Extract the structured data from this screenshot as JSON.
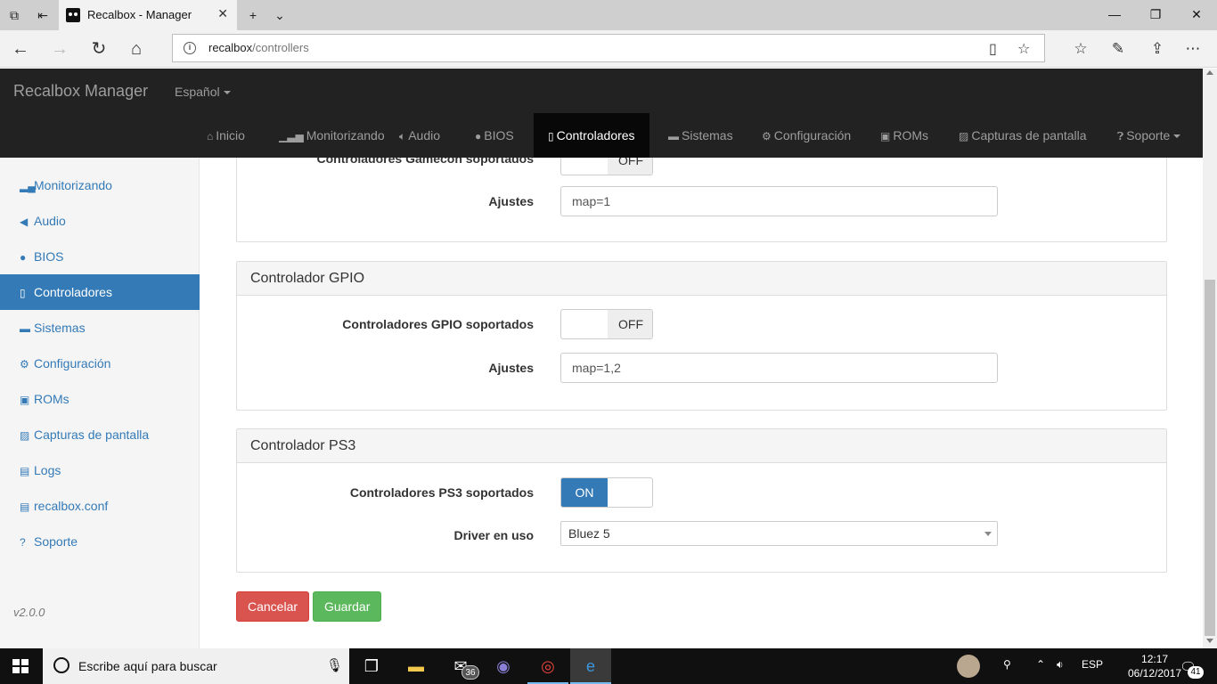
{
  "browser": {
    "tab_title": "Recalbox - Manager",
    "url_host": "recalbox",
    "url_path": "/controllers"
  },
  "navbar": {
    "brand": "Recalbox Manager",
    "language": "Español",
    "items": [
      {
        "label": "Inicio",
        "icon": "home-icon"
      },
      {
        "label": "Monitorizando",
        "icon": "signal-icon"
      },
      {
        "label": "Audio",
        "icon": "volume-icon"
      },
      {
        "label": "BIOS",
        "icon": "globe-icon"
      },
      {
        "label": "Controladores",
        "icon": "phone-icon"
      },
      {
        "label": "Sistemas",
        "icon": "hdd-icon"
      },
      {
        "label": "Configuración",
        "icon": "cog-icon"
      },
      {
        "label": "ROMs",
        "icon": "floppy-icon"
      },
      {
        "label": "Capturas de pantalla",
        "icon": "picture-icon"
      },
      {
        "label": "Soporte",
        "icon": "question-icon"
      }
    ]
  },
  "sidebar": {
    "items": [
      {
        "label": "Monitorizando"
      },
      {
        "label": "Audio"
      },
      {
        "label": "BIOS"
      },
      {
        "label": "Controladores"
      },
      {
        "label": "Sistemas"
      },
      {
        "label": "Configuración"
      },
      {
        "label": "ROMs"
      },
      {
        "label": "Capturas de pantalla"
      },
      {
        "label": "Logs"
      },
      {
        "label": "recalbox.conf"
      },
      {
        "label": "Soporte"
      }
    ],
    "version": "v2.0.0"
  },
  "gamecon": {
    "supported_label": "Controladores Gamecon soportados",
    "supported_state": "OFF",
    "settings_label": "Ajustes",
    "settings_value": "map=1"
  },
  "gpio": {
    "title": "Controlador GPIO",
    "supported_label": "Controladores GPIO soportados",
    "supported_state": "OFF",
    "settings_label": "Ajustes",
    "settings_value": "map=1,2"
  },
  "ps3": {
    "title": "Controlador PS3",
    "supported_label": "Controladores PS3 soportados",
    "supported_state": "ON",
    "driver_label": "Driver en uso",
    "driver_value": "Bluez 5"
  },
  "actions": {
    "cancel": "Cancelar",
    "save": "Guardar"
  },
  "taskbar": {
    "search_placeholder": "Escribe aquí para buscar",
    "mail_badge": "36",
    "language": "ESP",
    "time": "12:17",
    "date": "06/12/2017",
    "notifications": "41"
  }
}
